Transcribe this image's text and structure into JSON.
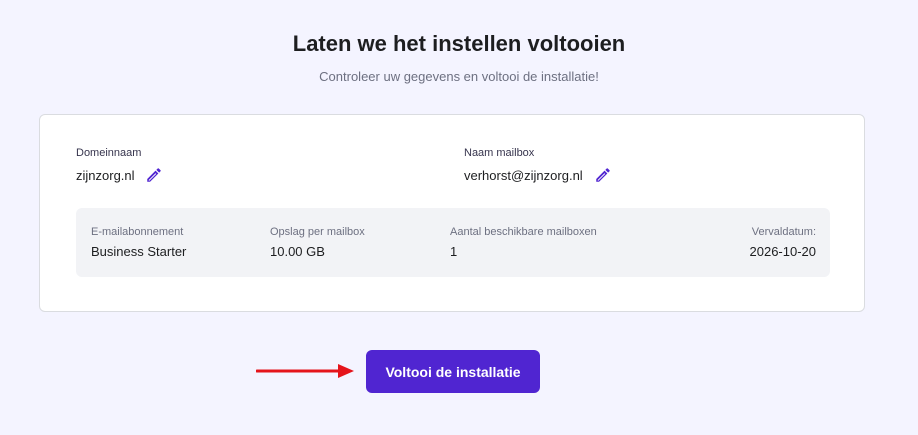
{
  "header": {
    "title": "Laten we het instellen voltooien",
    "subtitle": "Controleer uw gegevens en voltooi de installatie!"
  },
  "domain": {
    "label": "Domeinnaam",
    "value": "zijnzorg.nl",
    "edit_icon": "pencil-icon"
  },
  "mailbox": {
    "label": "Naam mailbox",
    "value": "verhorst@zijnzorg.nl",
    "edit_icon": "pencil-icon"
  },
  "details": {
    "plan": {
      "label": "E-mailabonnement",
      "value": "Business Starter"
    },
    "storage": {
      "label": "Opslag per mailbox",
      "value": "10.00 GB"
    },
    "mailboxes": {
      "label": "Aantal beschikbare mailboxen",
      "value": "1"
    },
    "expiry": {
      "label": "Vervaldatum:",
      "value": "2026-10-20"
    }
  },
  "cta": {
    "label": "Voltooi de installatie"
  },
  "colors": {
    "accent": "#5025d1",
    "page_bg": "#f4f4ff",
    "arrow": "#e5141b"
  }
}
